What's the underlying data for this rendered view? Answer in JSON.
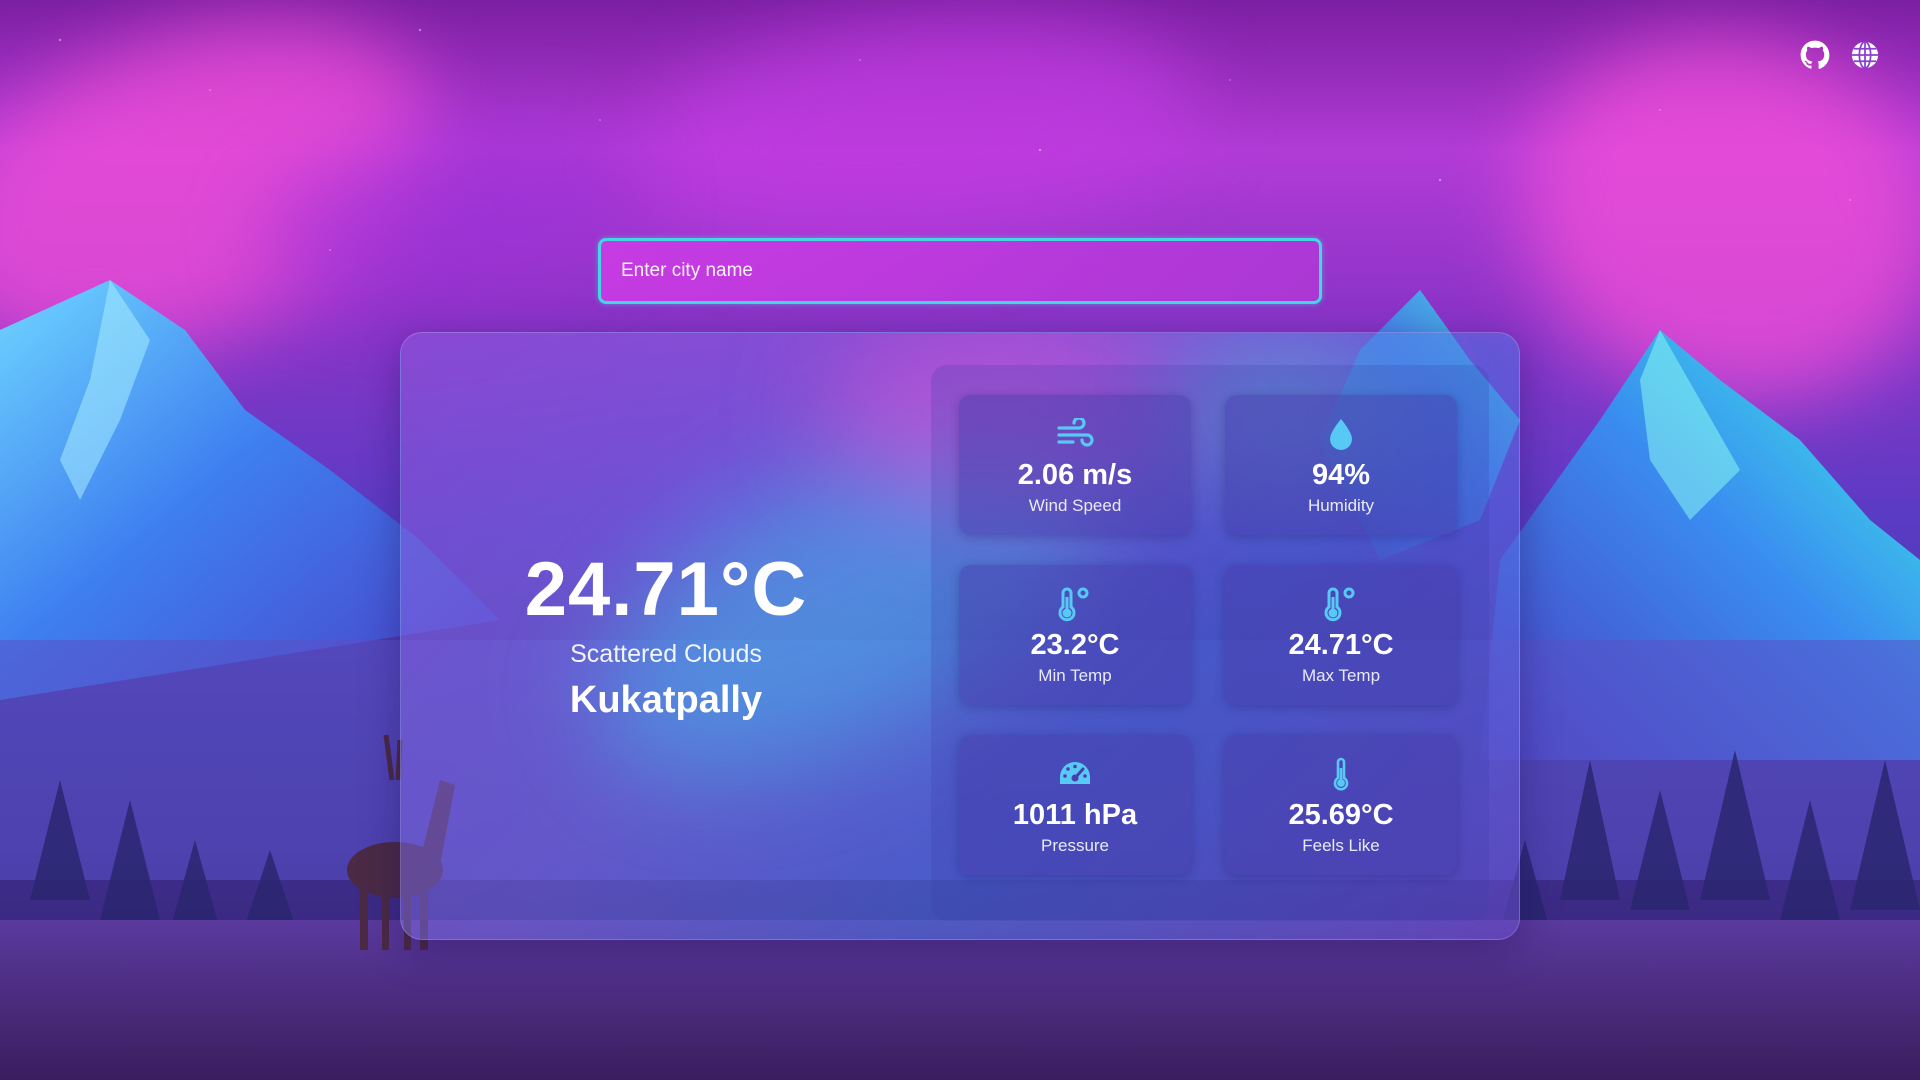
{
  "header": {
    "github_icon": "github-icon",
    "language_icon": "globe-icon"
  },
  "search": {
    "placeholder": "Enter city name",
    "value": ""
  },
  "current": {
    "temperature": "24.71°C",
    "description": "Scattered Clouds",
    "city": "Kukatpally"
  },
  "stats": [
    {
      "icon": "wind-icon",
      "value": "2.06 m/s",
      "label": "Wind Speed"
    },
    {
      "icon": "humidity-drop-icon",
      "value": "94%",
      "label": "Humidity"
    },
    {
      "icon": "thermometer-icon",
      "value": "23.2°C",
      "label": "Min Temp"
    },
    {
      "icon": "thermometer-icon",
      "value": "24.71°C",
      "label": "Max Temp"
    },
    {
      "icon": "pressure-gauge-icon",
      "value": "1011 hPa",
      "label": "Pressure"
    },
    {
      "icon": "thermometer-icon",
      "value": "25.69°C",
      "label": "Feels Like"
    }
  ],
  "colors": {
    "accent_border": "#45d6e6",
    "icon_blue": "#58c8f5"
  }
}
